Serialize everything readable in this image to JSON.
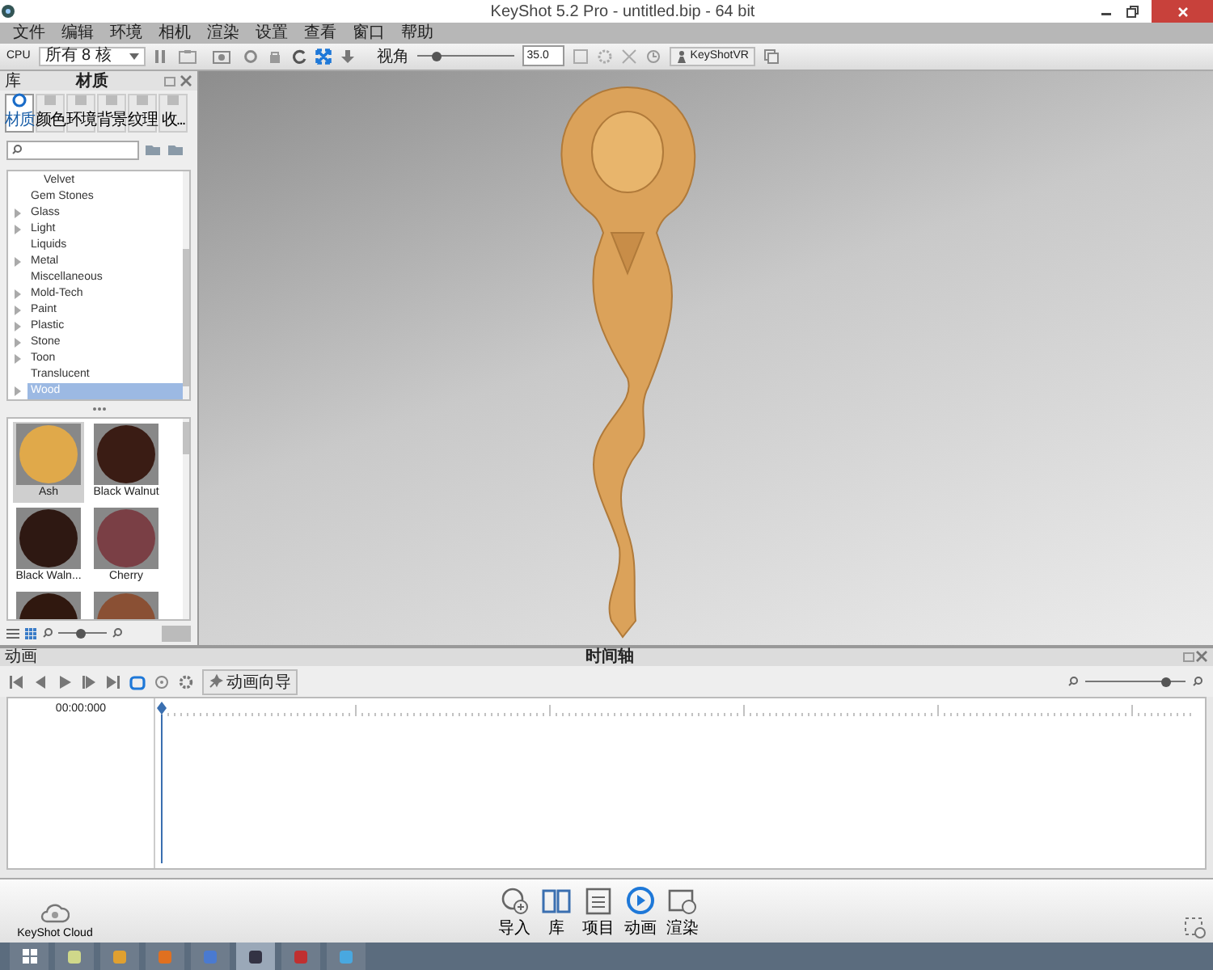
{
  "window": {
    "title": "KeyShot 5.2 Pro  - untitled.bip  - 64 bit"
  },
  "menu": [
    "文件",
    "编辑",
    "环境",
    "相机",
    "渲染",
    "设置",
    "查看",
    "窗口",
    "帮助"
  ],
  "toolbar": {
    "cpu_label": "CPU",
    "cpu_select": "所有 8 核",
    "fov_label": "视角",
    "fov_slider": {
      "level": 0.2
    },
    "fov_value": "35.0",
    "vr_button": "KeyShotVR"
  },
  "library": {
    "title": "库",
    "heading": "材质",
    "tabs": [
      {
        "label": "材质",
        "selected": true
      },
      {
        "label": "颜色",
        "selected": false
      },
      {
        "label": "环境",
        "selected": false
      },
      {
        "label": "背景",
        "selected": false
      },
      {
        "label": "纹理",
        "selected": false
      },
      {
        "label": "收...",
        "selected": false
      }
    ],
    "tree": [
      {
        "label": "Velvet",
        "kind": "subitem",
        "selected": false
      },
      {
        "label": "Gem Stones",
        "kind": "leaf",
        "selected": false
      },
      {
        "label": "Glass",
        "kind": "folder",
        "selected": false
      },
      {
        "label": "Light",
        "kind": "folder",
        "selected": false
      },
      {
        "label": "Liquids",
        "kind": "leaf",
        "selected": false
      },
      {
        "label": "Metal",
        "kind": "folder",
        "selected": false
      },
      {
        "label": "Miscellaneous",
        "kind": "leaf",
        "selected": false
      },
      {
        "label": "Mold-Tech",
        "kind": "folder",
        "selected": false
      },
      {
        "label": "Paint",
        "kind": "folder",
        "selected": false
      },
      {
        "label": "Plastic",
        "kind": "folder",
        "selected": false
      },
      {
        "label": "Stone",
        "kind": "folder",
        "selected": false
      },
      {
        "label": "Toon",
        "kind": "folder",
        "selected": false
      },
      {
        "label": "Translucent",
        "kind": "leaf",
        "selected": false
      },
      {
        "label": "Wood",
        "kind": "folder",
        "selected": true
      }
    ],
    "materials": [
      {
        "label": "Ash",
        "color": "#e0a94a",
        "selected": true
      },
      {
        "label": "Black Walnut",
        "color": "#3a1c14",
        "selected": false
      },
      {
        "label": "Black Waln...",
        "color": "#2e1812",
        "selected": false
      },
      {
        "label": "Cherry",
        "color": "#7a3f45",
        "selected": false
      },
      {
        "color": "#30180f",
        "selected": false
      },
      {
        "color": "#8a5034",
        "selected": false
      }
    ],
    "size_slider": {
      "level": 0.45
    }
  },
  "animation": {
    "title": "动画",
    "heading": "时间轴",
    "wizard_button": "动画向导",
    "time": "00:00:000",
    "zoom_slider": {
      "level": 0.8
    }
  },
  "bottom_bar": {
    "cloud": "KeyShot Cloud",
    "buttons": [
      {
        "label": "导入",
        "kind": "import"
      },
      {
        "label": "库",
        "kind": "library"
      },
      {
        "label": "项目",
        "kind": "project"
      },
      {
        "label": "动画",
        "kind": "animation"
      },
      {
        "label": "渲染",
        "kind": "render"
      }
    ]
  }
}
